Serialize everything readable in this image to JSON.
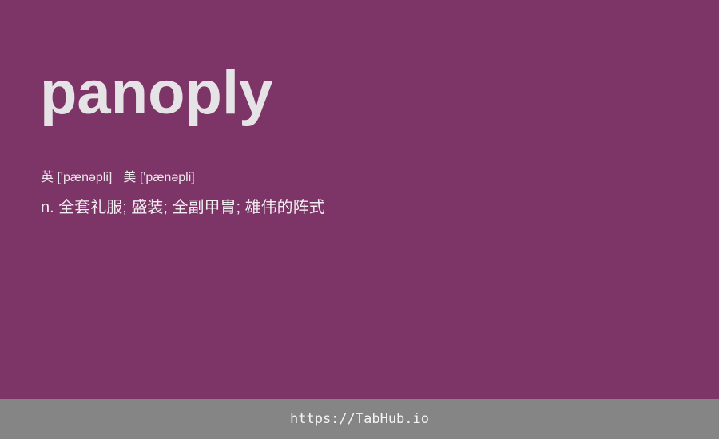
{
  "word": "panoply",
  "phonetics": {
    "uk_label": "英",
    "uk_ipa": "['pænəpli]",
    "us_label": "美",
    "us_ipa": "['pænəpli]"
  },
  "definition": "n. 全套礼服; 盛装; 全副甲胄; 雄伟的阵式",
  "footer": {
    "link_text": "https://TabHub.io"
  },
  "colors": {
    "background": "#7c3566",
    "footer_background": "#858585",
    "text": "#e6e3e6"
  }
}
